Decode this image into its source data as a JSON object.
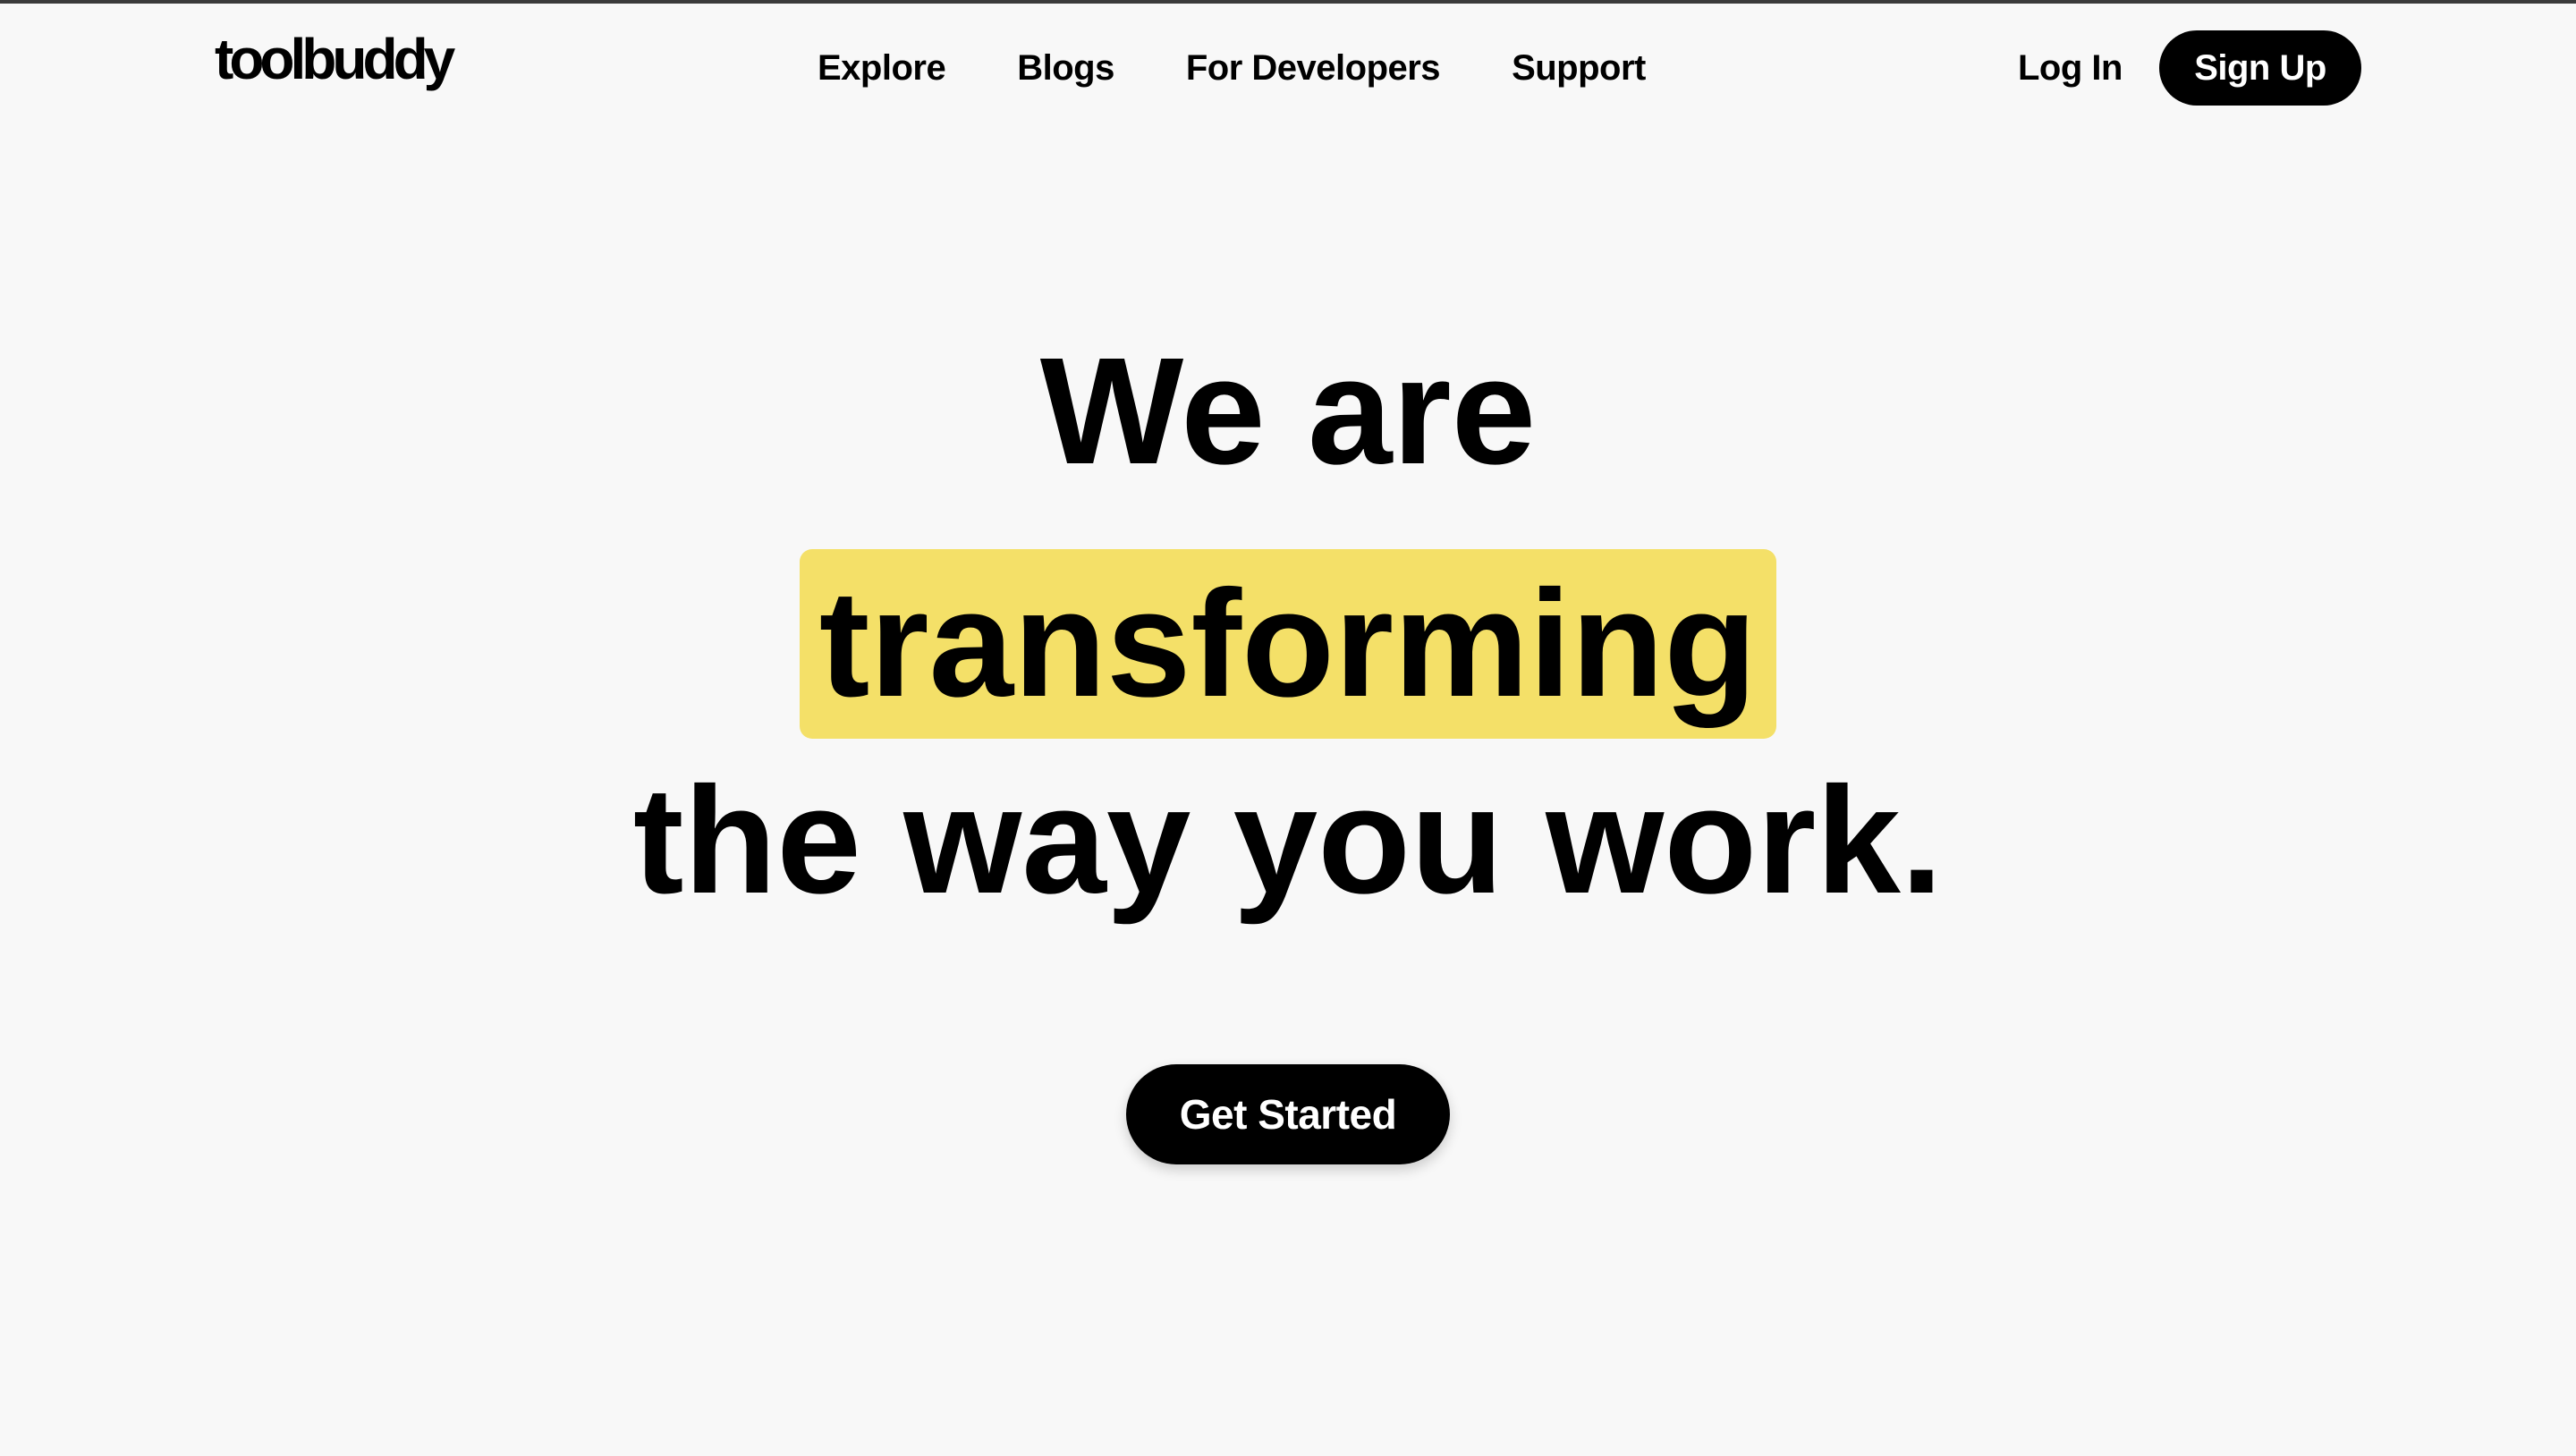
{
  "brand": {
    "logo_text": "toolbuddy"
  },
  "nav": {
    "items": [
      {
        "label": "Explore"
      },
      {
        "label": "Blogs"
      },
      {
        "label": "For Developers"
      },
      {
        "label": "Support"
      }
    ]
  },
  "auth": {
    "login_label": "Log In",
    "signup_label": "Sign Up"
  },
  "hero": {
    "line1": "We are",
    "highlight": "transforming",
    "line3": "the way you work.",
    "cta_label": "Get Started"
  },
  "colors": {
    "background": "#f8f8f8",
    "highlight": "#f4e068",
    "button": "#000000",
    "button_text": "#ffffff"
  }
}
